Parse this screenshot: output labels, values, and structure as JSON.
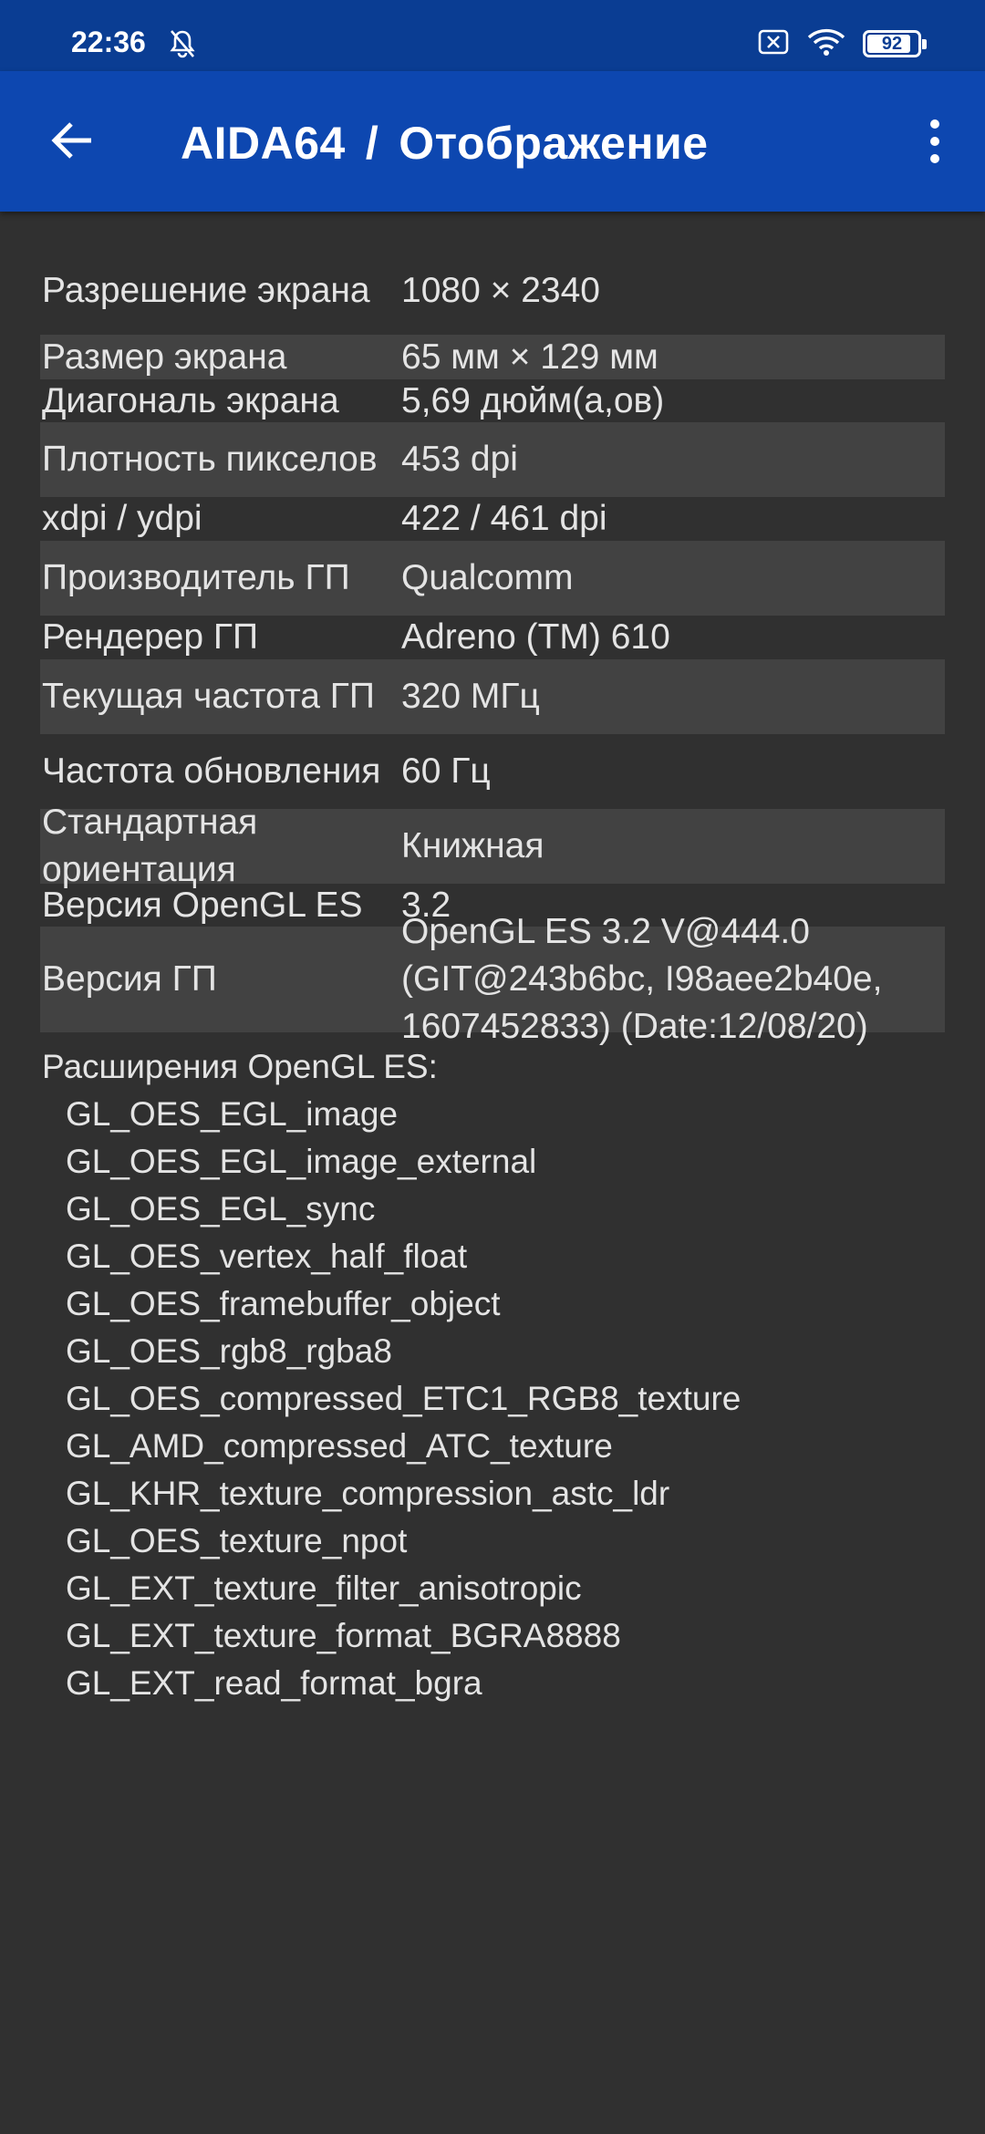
{
  "status_bar": {
    "time": "22:36",
    "battery": "92",
    "battery_level": 0.92,
    "icons": [
      "bell-off-icon",
      "sim-x-icon",
      "wifi-icon",
      "battery-icon"
    ]
  },
  "app_bar": {
    "app_name": "AIDA64",
    "separator": "/",
    "page_title": "Отображение",
    "color": "#0d47b0"
  },
  "rows": [
    {
      "label": "Разрешение экрана",
      "value": "1080 × 2340"
    },
    {
      "label": "Размер экрана",
      "value": "65 мм × 129 мм"
    },
    {
      "label": "Диагональ экрана",
      "value": "5,69 дюйм(а,ов)"
    },
    {
      "label": "Плотность пикселов",
      "value": "453 dpi"
    },
    {
      "label": "xdpi / ydpi",
      "value": "422 / 461 dpi"
    },
    {
      "label": "Производитель ГП",
      "value": "Qualcomm"
    },
    {
      "label": "Рендерер ГП",
      "value": "Adreno (TM) 610"
    },
    {
      "label": "Текущая частота ГП",
      "value": "320 МГц"
    },
    {
      "label": "Частота обновления",
      "value": "60 Гц"
    },
    {
      "label": "Стандартная ориентация",
      "value": "Книжная"
    },
    {
      "label": "Версия OpenGL ES",
      "value": "3.2"
    },
    {
      "label": "Версия ГП",
      "value": "OpenGL ES 3.2 V@444.0 (GIT@243b6bc, I98aee2b40e, 1607452833) (Date:12/08/20)"
    }
  ],
  "extensions_title": "Расширения OpenGL ES:",
  "extensions": [
    "GL_OES_EGL_image",
    "GL_OES_EGL_image_external",
    "GL_OES_EGL_sync",
    "GL_OES_vertex_half_float",
    "GL_OES_framebuffer_object",
    "GL_OES_rgb8_rgba8",
    "GL_OES_compressed_ETC1_RGB8_texture",
    "GL_AMD_compressed_ATC_texture",
    "GL_KHR_texture_compression_astc_ldr",
    "GL_OES_texture_npot",
    "GL_EXT_texture_filter_anisotropic",
    "GL_EXT_texture_format_BGRA8888",
    "GL_EXT_read_format_bgra"
  ]
}
